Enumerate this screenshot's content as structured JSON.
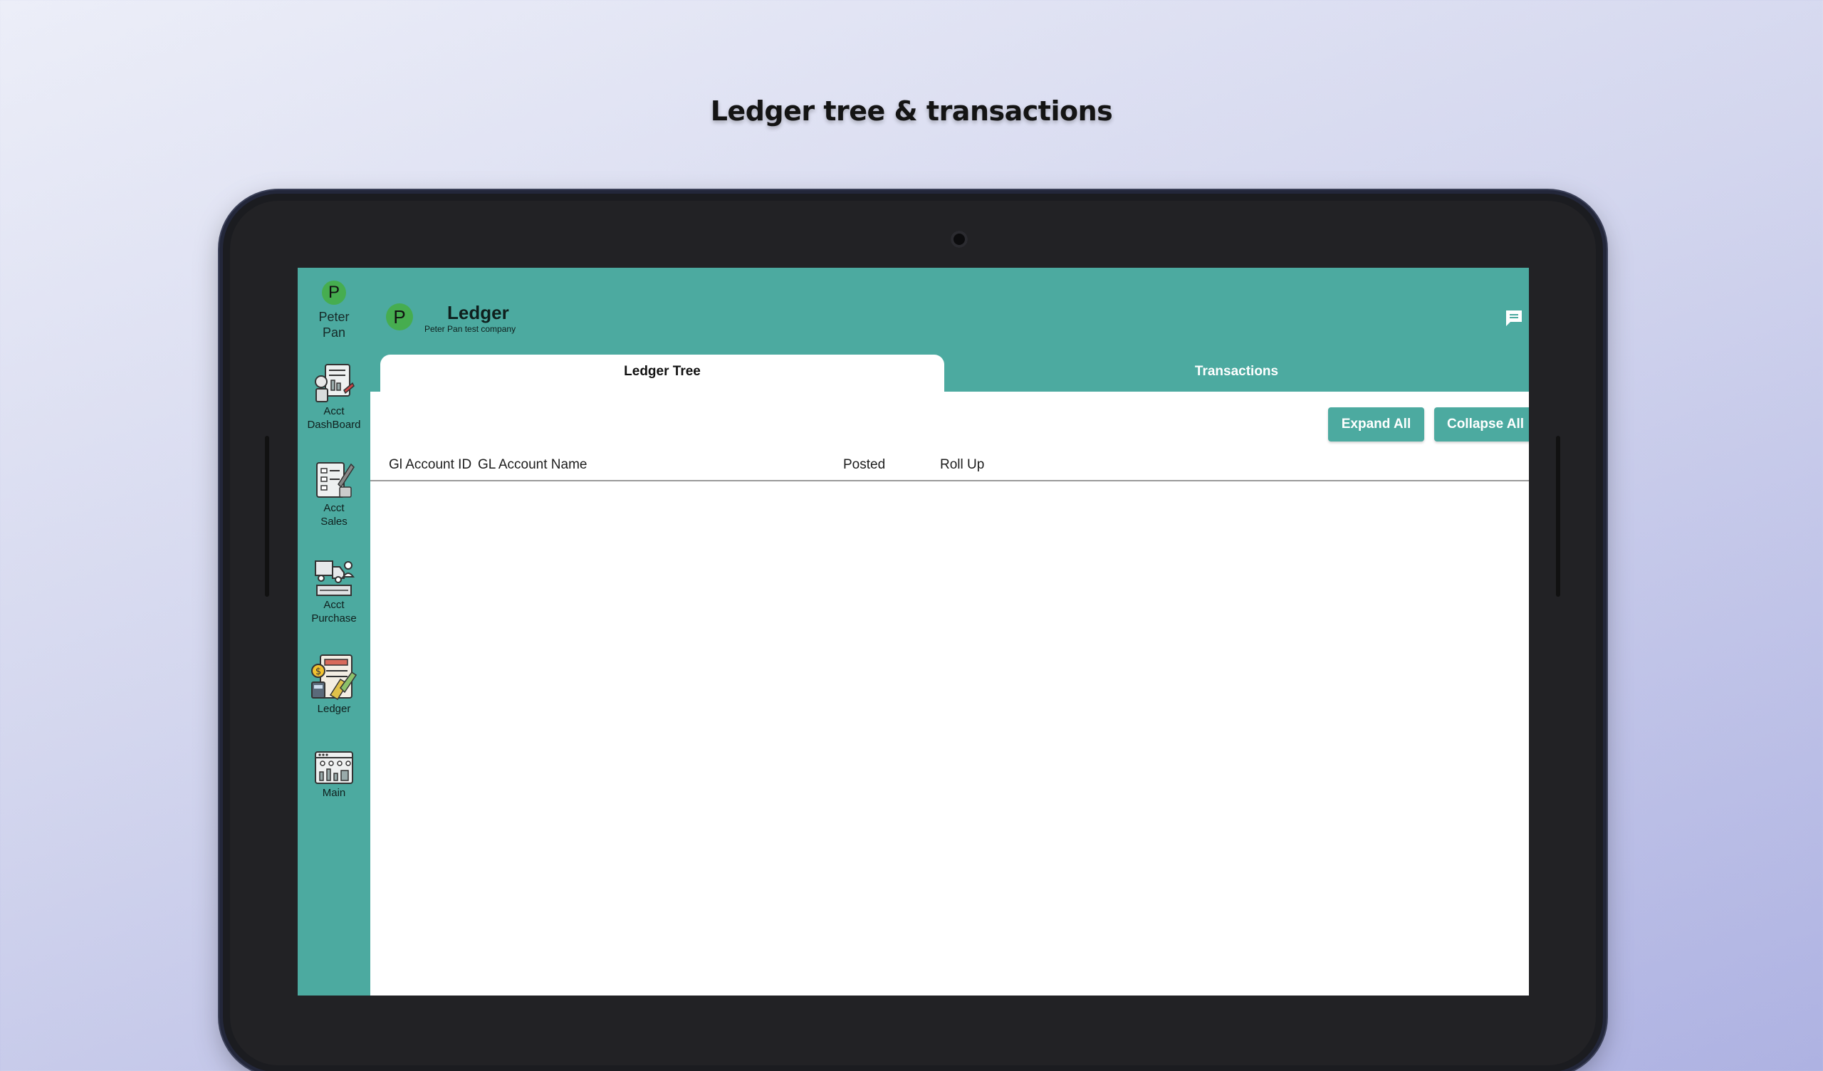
{
  "headline": "Ledger tree & transactions",
  "rail": {
    "avatar_initial": "P",
    "user_first": "Peter",
    "user_last": "Pan",
    "items": [
      {
        "line1": "Acct",
        "line2": "DashBoard",
        "icon": "accounting-dashboard-icon"
      },
      {
        "line1": "Acct",
        "line2": "Sales",
        "icon": "accounting-sales-icon"
      },
      {
        "line1": "Acct",
        "line2": "Purchase",
        "icon": "accounting-purchase-icon"
      },
      {
        "line1": "Ledger",
        "icon": "ledger-icon"
      },
      {
        "line1": "Main",
        "icon": "main-dashboard-icon"
      }
    ]
  },
  "header": {
    "avatar_initial": "P",
    "title": "Ledger",
    "subtitle": "Peter Pan test company",
    "chat_icon": "chat-icon"
  },
  "tabs": [
    {
      "label": "Ledger Tree",
      "active": true
    },
    {
      "label": "Transactions",
      "active": false
    }
  ],
  "toolbar": {
    "expand_label": "Expand All",
    "collapse_label": "Collapse All"
  },
  "table": {
    "columns": [
      "Gl Account ID",
      "GL Account Name",
      "Posted",
      "Roll Up"
    ],
    "rows": []
  },
  "colors": {
    "accent": "#4caaa0",
    "avatar": "#46ad4f",
    "tablet_frame": "#1b1c20"
  }
}
